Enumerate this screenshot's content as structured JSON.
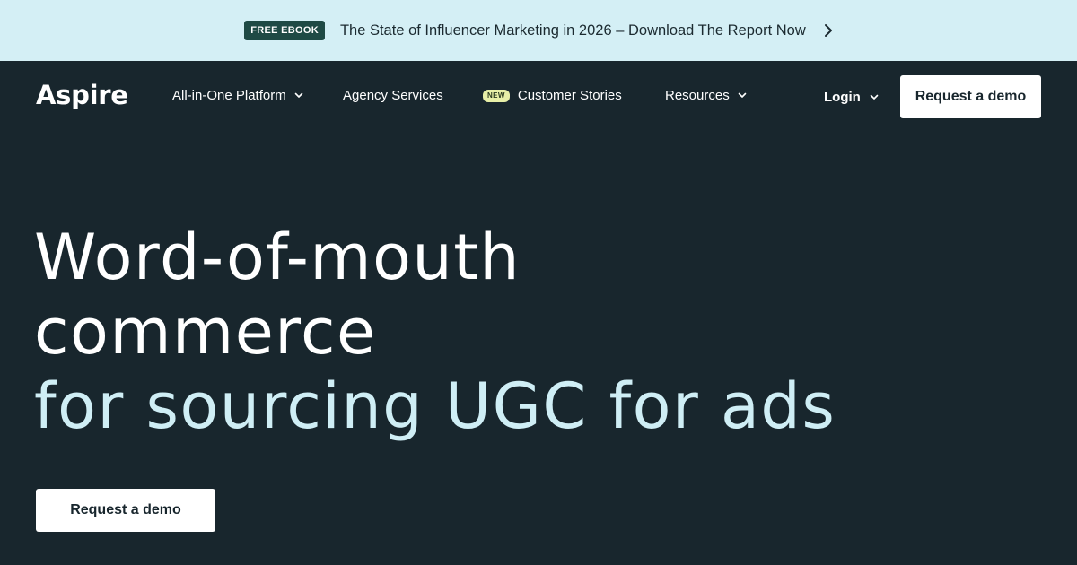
{
  "announcement": {
    "badge": "FREE EBOOK",
    "text": "The State of Influencer Marketing in 2026 – Download The Report Now"
  },
  "nav": {
    "logo": "Aspire",
    "items": [
      {
        "label": "All-in-One Platform",
        "has_dropdown": true
      },
      {
        "label": "Agency Services",
        "has_dropdown": false
      },
      {
        "label": "Customer Stories",
        "badge": "NEW",
        "has_dropdown": false
      },
      {
        "label": "Resources",
        "has_dropdown": true
      }
    ],
    "login_label": "Login",
    "cta_label": "Request a demo"
  },
  "hero": {
    "line1": "Word-of-mouth",
    "line2": "commerce",
    "line3": "for sourcing UGC for ads",
    "cta_label": "Request a demo"
  },
  "colors": {
    "background": "#18262d",
    "banner": "#d4eff5",
    "accent": "#cfeef5",
    "badge": "#1f4a45",
    "new_badge": "#e7efa7"
  }
}
